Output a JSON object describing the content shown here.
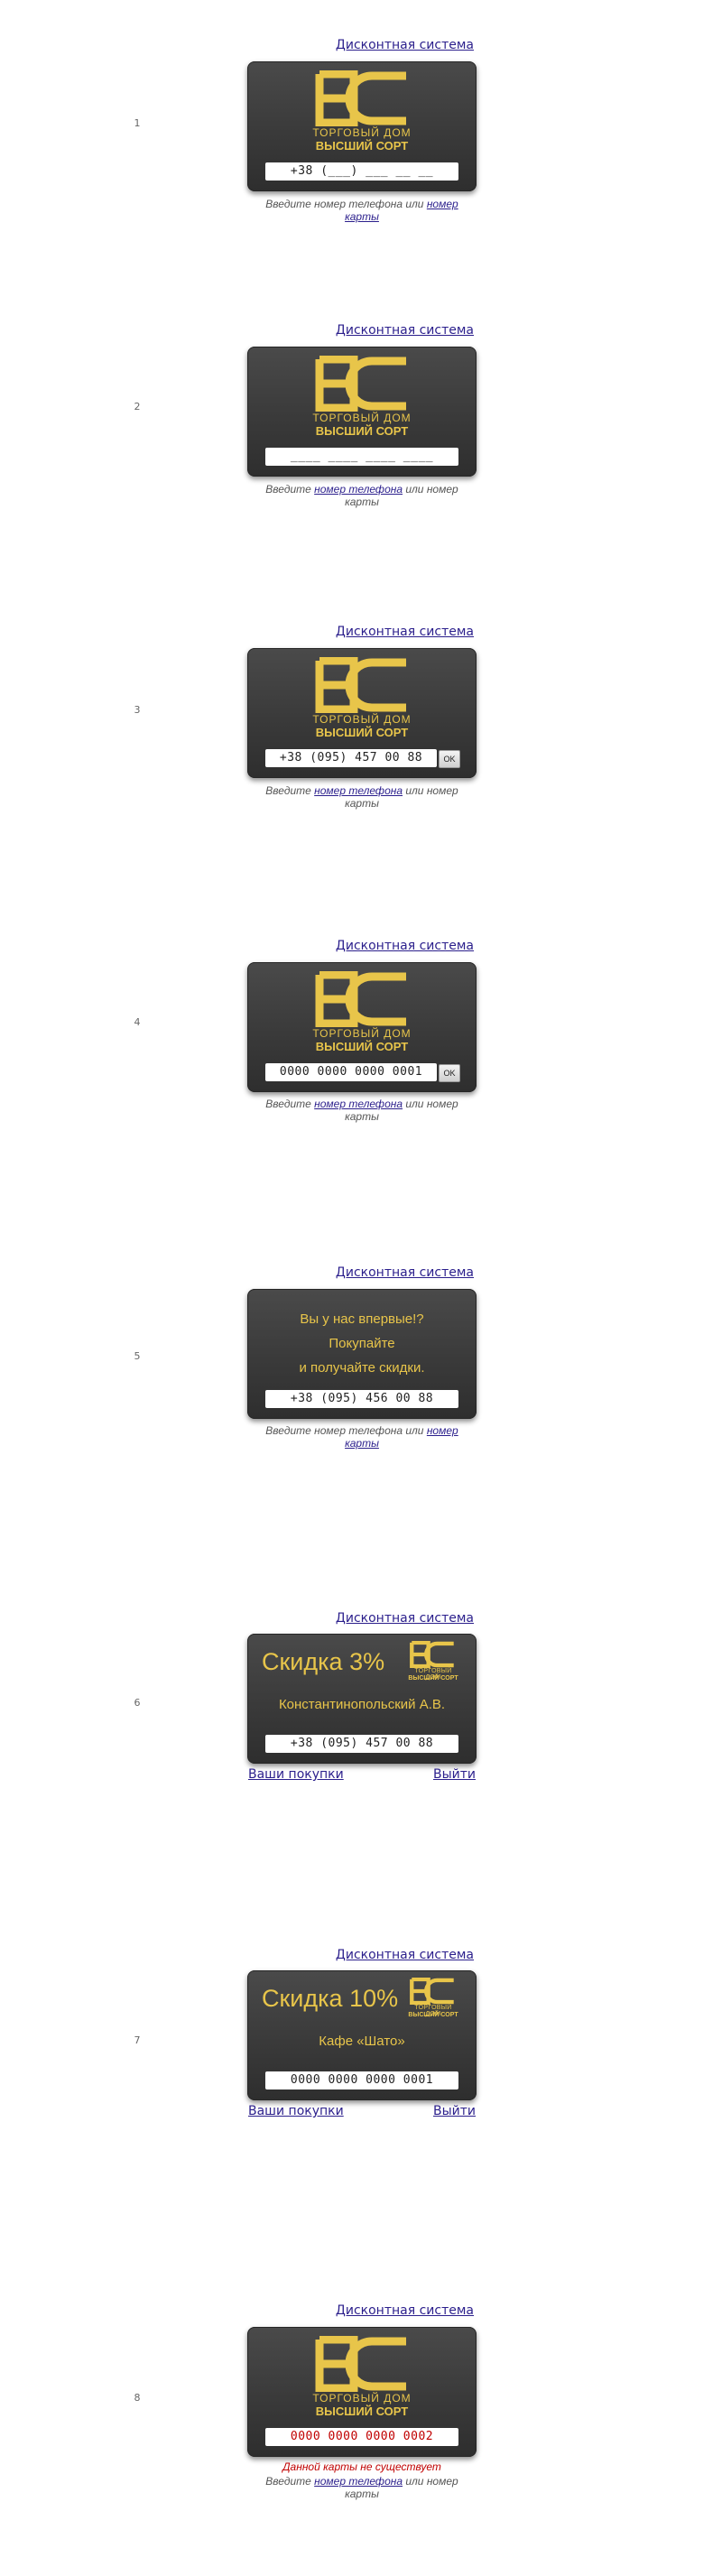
{
  "top_link": "Дисконтная система",
  "ok_label": "OK",
  "brand": {
    "line1": "ТОРГОВЫЙ ДОМ",
    "line2": "ВЫСШИЙ СОРТ"
  },
  "hint": {
    "prefix": "Введите ",
    "phone": "номер телефона",
    "middle": " или ",
    "card": "номер карты"
  },
  "colors": {
    "gold": "#e8c54a",
    "card_bg": "#3d3d3d",
    "link": "#2b1f8c",
    "error": "#c00000"
  },
  "variants": [
    {
      "number": "1",
      "field": "+38 (___) ___ __ __"
    },
    {
      "number": "2",
      "field": "____ ____ ____ ____"
    },
    {
      "number": "3",
      "field": "+38 (095) 457 00 88"
    },
    {
      "number": "4",
      "field": "0000 0000 0000 0001"
    },
    {
      "number": "5",
      "field": "+38 (095) 456 00 88",
      "message": [
        "Вы у нас впервые!?",
        "Покупайте",
        "и получайте скидки."
      ]
    },
    {
      "number": "6",
      "field": "+38 (095) 457 00 88",
      "discount": "Скидка 3%",
      "owner": "Константинопольский А.В.",
      "purchases": "Ваши покупки",
      "logout": "Выйти"
    },
    {
      "number": "7",
      "field": "0000 0000 0000 0001",
      "discount": "Скидка 10%",
      "owner": "Кафе «Шато»",
      "purchases": "Ваши покупки",
      "logout": "Выйти"
    },
    {
      "number": "8",
      "field": "0000 0000 0000 0002",
      "error": "Данной карты не существует"
    }
  ]
}
